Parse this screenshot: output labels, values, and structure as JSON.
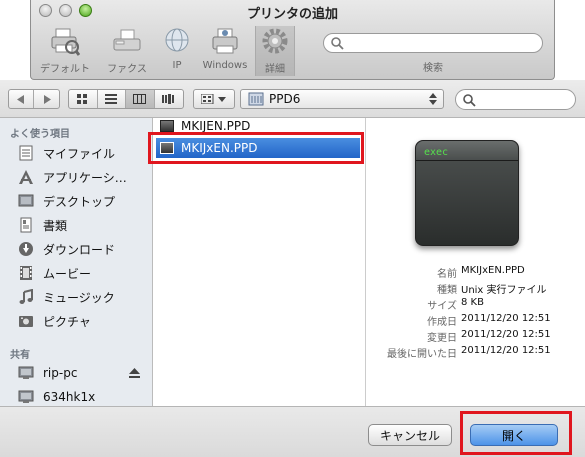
{
  "window": {
    "title": "プリンタの追加"
  },
  "toolbar": {
    "items": [
      {
        "label": "デフォルト",
        "icon": "default-printer-icon"
      },
      {
        "label": "ファクス",
        "icon": "fax-icon"
      },
      {
        "label": "IP",
        "icon": "ip-globe-icon"
      },
      {
        "label": "Windows",
        "icon": "windows-printer-icon"
      },
      {
        "label": "詳細",
        "icon": "gear-icon"
      }
    ],
    "search_label": "検索"
  },
  "navbar": {
    "path": "PPD6"
  },
  "sidebar": {
    "favorites_heading": "よく使う項目",
    "favorites": [
      {
        "label": "マイファイル",
        "icon": "my-files-icon"
      },
      {
        "label": "アプリケーシ…",
        "icon": "applications-icon"
      },
      {
        "label": "デスクトップ",
        "icon": "desktop-icon"
      },
      {
        "label": "書類",
        "icon": "documents-icon"
      },
      {
        "label": "ダウンロード",
        "icon": "downloads-icon"
      },
      {
        "label": "ムービー",
        "icon": "movies-icon"
      },
      {
        "label": "ミュージック",
        "icon": "music-icon"
      },
      {
        "label": "ピクチャ",
        "icon": "pictures-icon"
      }
    ],
    "shared_heading": "共有",
    "shared": [
      {
        "label": "rip-pc",
        "icon": "computer-icon"
      },
      {
        "label": "634hk1x",
        "icon": "computer-icon"
      }
    ]
  },
  "files": [
    {
      "name": "MKIJEN.PPD"
    },
    {
      "name": "MKIJxEN.PPD",
      "selected": true
    }
  ],
  "preview": {
    "icon_text": "exec",
    "info": [
      {
        "key": "名前",
        "value": "MKIJxEN.PPD"
      },
      {
        "key": "種類",
        "value": "Unix 実行ファイル"
      },
      {
        "key": "サイズ",
        "value": "8 KB"
      },
      {
        "key": "作成日",
        "value": "2011/12/20 12:51"
      },
      {
        "key": "変更日",
        "value": "2011/12/20 12:51"
      },
      {
        "key": "最後に開いた日",
        "value": "2011/12/20 12:51"
      }
    ]
  },
  "buttons": {
    "cancel": "キャンセル",
    "open": "開く"
  },
  "colors": {
    "highlight": "#e0161e",
    "selection": "#2f74d0",
    "primary_button": "#4d93e8"
  }
}
